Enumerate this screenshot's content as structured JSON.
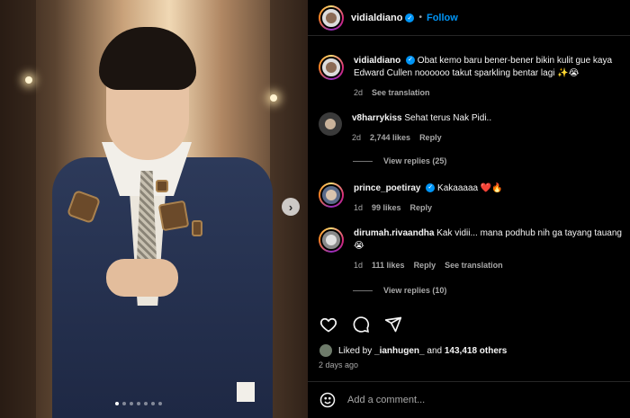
{
  "post": {
    "username": "vidialdiano",
    "separator": "•",
    "follow_label": "Follow",
    "carousel_dot_count": 7,
    "carousel_active_index": 0
  },
  "caption": {
    "username": "vidialdiano",
    "text": "Obat kemo baru bener-bener bikin kulit gue kaya Edward Cullen noooooo takut sparkling bentar lagi ✨😭",
    "age": "2d",
    "see_translation": "See translation"
  },
  "comments": [
    {
      "username": "v8harrykiss",
      "text": "Sehat terus Nak Pidi..",
      "age": "2d",
      "likes": "2,744 likes",
      "reply": "Reply",
      "view_replies": "View replies (25)"
    },
    {
      "username": "prince_poetiray",
      "verified": true,
      "text": "Kakaaaaa ❤️🔥",
      "age": "1d",
      "likes": "99 likes",
      "reply": "Reply"
    },
    {
      "username": "dirumah.rivaandha",
      "text": "Kak vidii... mana podhub nih ga tayang tauang 😭",
      "age": "1d",
      "likes": "111 likes",
      "reply": "Reply",
      "see_translation": "See translation",
      "view_replies": "View replies (10)"
    }
  ],
  "footer": {
    "liked_by_prefix": "Liked by ",
    "liked_by_user": "_ianhugen_",
    "liked_by_mid": " and ",
    "liked_by_count": "143,418 others",
    "date": "2 days ago",
    "add_comment_placeholder": "Add a comment..."
  },
  "colors": {
    "accent": "#0095f6",
    "background": "#000000",
    "muted": "#a8a8a8"
  }
}
